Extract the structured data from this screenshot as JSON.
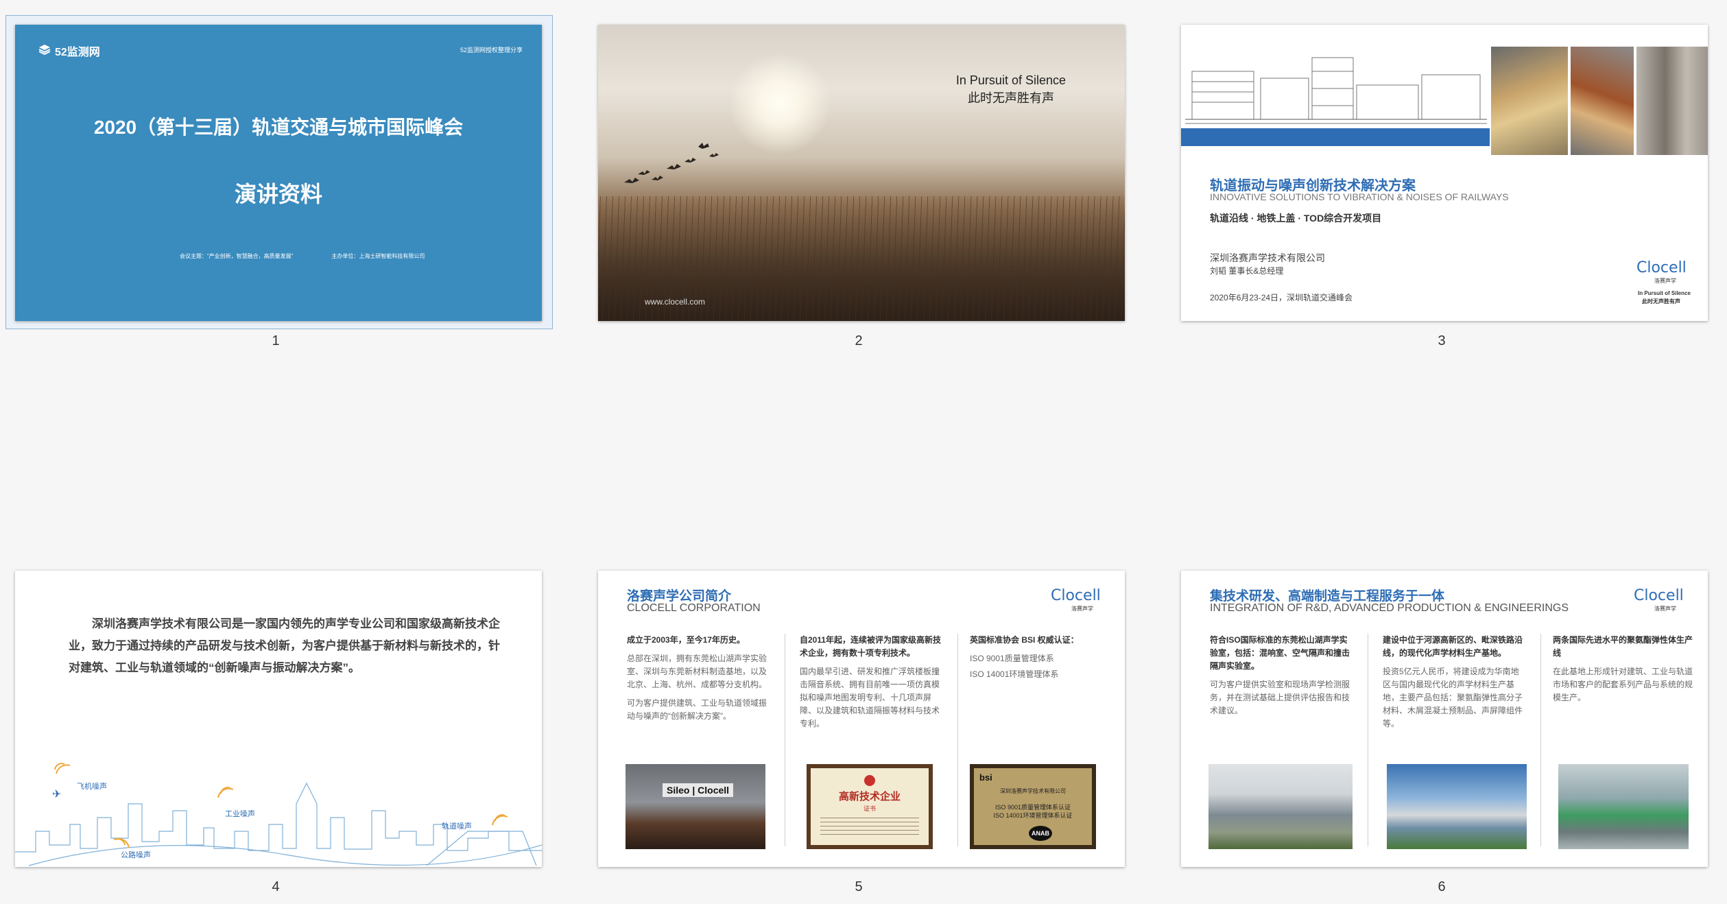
{
  "slide_numbers": [
    "1",
    "2",
    "3",
    "4",
    "5",
    "6"
  ],
  "slide1": {
    "logo": "52监测网",
    "top_right": "52监测网授权整理分享",
    "title": "2020（第十三届）轨道交通与城市国际峰会",
    "subtitle": "演讲资料",
    "footer_left": "会议主题：“产业创新，智慧融合，高质量发展”",
    "footer_right": "主办单位：上海土研智能科技有限公司"
  },
  "slide2": {
    "caption_en": "In Pursuit of Silence",
    "caption_cn": "此时无声胜有声",
    "website": "www.clocell.com"
  },
  "slide3": {
    "title_cn": "轨道振动与噪声创新技术解决方案",
    "title_en": "INNOVATIVE SOLUTIONS TO VIBRATION & NOISES OF RAILWAYS",
    "tags": "轨道沿线 · 地铁上盖 · TOD综合开发项目",
    "company": "深圳洛赛声学技术有限公司",
    "person": "刘韬  董事长&总经理",
    "event": "2020年6月23-24日，深圳轨道交通峰会",
    "brand": "Clocell",
    "brand_cn": "洛赛声学",
    "slogan_en": "In Pursuit of Silence",
    "slogan_cn": "此时无声胜有声"
  },
  "slide4": {
    "paragraph": "深圳洛赛声学技术有限公司是一家国内领先的声学专业公司和国家级高新技术企业，致力于通过持续的产品研发与技术创新，为客户提供基于新材料与新技术的，针对建筑、工业与轨道领域的“创新噪声与振动解决方案”。",
    "labels": {
      "plane": "飞机噪声",
      "industry": "工业噪声",
      "road": "公路噪声",
      "rail": "轨道噪声"
    }
  },
  "slide5": {
    "title_cn": "洛赛声学公司简介",
    "title_en": "CLOCELL CORPORATION",
    "brand": "Clocell",
    "brand_cn": "洛赛声学",
    "col1_title": "成立于2003年，至今17年历史。",
    "col1_body1": "总部在深圳，拥有东莞松山湖声学实验室、深圳与东莞新材料制造基地，以及北京、上海、杭州、成都等分支机构。",
    "col1_body2": "可为客户提供建筑、工业与轨道领域振动与噪声的“创新解决方案”。",
    "col2_title": "自2011年起，连续被评为国家级高新技术企业，拥有数十项专利技术。",
    "col2_body": "国内最早引进、研发和推广浮筑楼板撞击隔音系统、拥有目前唯一一项仿真模拟和噪声地图发明专利、十几项声屏障、以及建筑和轨道隔振等材料与技术专利。",
    "col3_title": "英国标准协会 BSI 权威认证：",
    "col3_item1": "ISO 9001质量管理体系",
    "col3_item2": "ISO 14001环境管理体系",
    "photo_sign": "Sileo | Clocell",
    "cert1_title": "高新技术企业",
    "cert1_sub": "证书",
    "cert2_logo": "bsi",
    "cert2_line1": "深圳洛赛声学技术有限公司",
    "cert2_line2": "ISO 9001质量管理体系认证",
    "cert2_line3": "ISO 14001环境管理体系认证",
    "cert2_badge": "ANAB"
  },
  "slide6": {
    "title_cn": "集技术研发、高端制造与工程服务于一体",
    "title_en": "INTEGRATION OF R&D, ADVANCED PRODUCTION & ENGINEERINGS",
    "brand": "Clocell",
    "brand_cn": "洛赛声学",
    "col1_title": "符合ISO国际标准的东莞松山湖声学实验室，包括：混响室、空气隔声和撞击隔声实验室。",
    "col1_body": "可为客户提供实验室和现场声学检测服务，并在测试基础上提供评估报告和技术建议。",
    "col2_title": "建设中位于河源高新区的、毗深铁路沿线，的现代化声学材料生产基地。",
    "col2_body": "投资5亿元人民币，将建设成为华南地区与国内最现代化的声学材料生产基地，主要产品包括：聚氨酯弹性高分子材料、木屑混凝土预制品、声屏障组件等。",
    "col3_title": "两条国际先进水平的聚氨酯弹性体生产线",
    "col3_body": "在此基地上形成针对建筑、工业与轨道市场和客户的配套系列产品与系统的规模生产。"
  }
}
